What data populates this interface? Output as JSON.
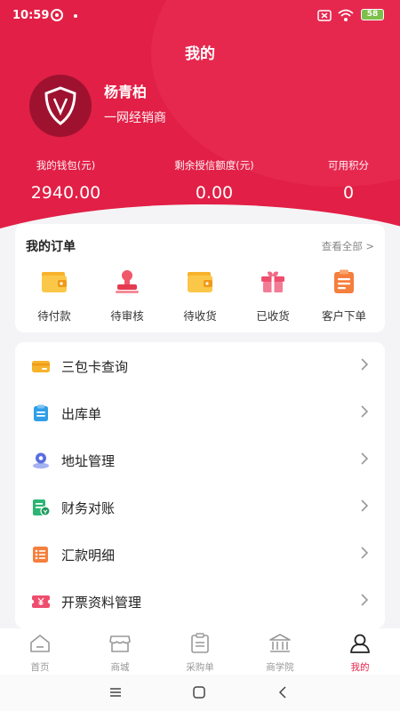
{
  "status_bar": {
    "time": "10:59",
    "battery": "58"
  },
  "page": {
    "title": "我的"
  },
  "profile": {
    "name": "杨青柏",
    "role": "一网经销商"
  },
  "stats": [
    {
      "label": "我的钱包(元)",
      "value": "2940.00"
    },
    {
      "label": "剩余授信额度(元)",
      "value": "0.00"
    },
    {
      "label": "可用积分",
      "value": "0"
    }
  ],
  "orders": {
    "title": "我的订单",
    "view_all": "查看全部 >",
    "items": [
      {
        "label": "待付款",
        "icon": "wallet-icon"
      },
      {
        "label": "待审核",
        "icon": "stamp-icon"
      },
      {
        "label": "待收货",
        "icon": "wallet-icon"
      },
      {
        "label": "已收货",
        "icon": "gift-box-icon"
      },
      {
        "label": "客户下单",
        "icon": "clipboard-icon"
      }
    ]
  },
  "menu": [
    {
      "label": "三包卡查询",
      "icon": "card-icon"
    },
    {
      "label": "出库单",
      "icon": "clipboard-icon"
    },
    {
      "label": "地址管理",
      "icon": "location-icon"
    },
    {
      "label": "财务对账",
      "icon": "ledger-icon"
    },
    {
      "label": "汇款明细",
      "icon": "list-icon"
    },
    {
      "label": "开票资料管理",
      "icon": "invoice-icon"
    }
  ],
  "tabs": [
    {
      "label": "首页",
      "icon": "home-icon",
      "active": false
    },
    {
      "label": "商城",
      "icon": "store-icon",
      "active": false
    },
    {
      "label": "采购单",
      "icon": "purchase-list-icon",
      "active": false
    },
    {
      "label": "商学院",
      "icon": "school-icon",
      "active": false
    },
    {
      "label": "我的",
      "icon": "user-icon",
      "active": true
    }
  ],
  "colors": {
    "brand": "#e21f46",
    "active_tab": "#e21f46"
  }
}
